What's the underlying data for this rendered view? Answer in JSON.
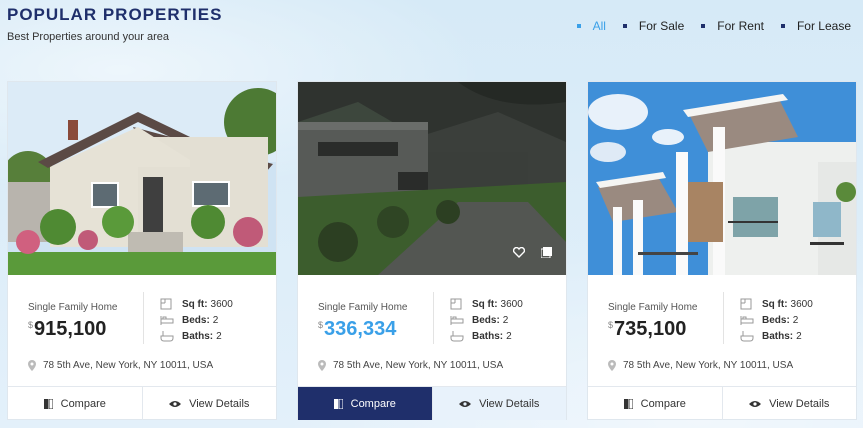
{
  "header": {
    "title": "POPULAR PROPERTIES",
    "subtitle": "Best Properties around your area"
  },
  "filters": [
    {
      "label": "All",
      "active": true
    },
    {
      "label": "For Sale",
      "active": false
    },
    {
      "label": "For Rent",
      "active": false
    },
    {
      "label": "For Lease",
      "active": false
    }
  ],
  "cards": [
    {
      "type": "Single Family Home",
      "currency": "$",
      "price": "915,100",
      "sqft_label": "Sq ft:",
      "sqft": "3600",
      "beds_label": "Beds:",
      "beds": "2",
      "baths_label": "Baths:",
      "baths": "2",
      "address": "78 5th Ave, New York, NY 10011, USA",
      "compare_label": "Compare",
      "details_label": "View Details"
    },
    {
      "type": "Single Family Home",
      "currency": "$",
      "price": "336,334",
      "sqft_label": "Sq ft:",
      "sqft": "3600",
      "beds_label": "Beds:",
      "beds": "2",
      "baths_label": "Baths:",
      "baths": "2",
      "address": "78 5th Ave, New York, NY 10011, USA",
      "compare_label": "Compare",
      "details_label": "View Details"
    },
    {
      "type": "Single Family Home",
      "currency": "$",
      "price": "735,100",
      "sqft_label": "Sq ft:",
      "sqft": "3600",
      "beds_label": "Beds:",
      "beds": "2",
      "baths_label": "Baths:",
      "baths": "2",
      "address": "78 5th Ave, New York, NY 10011, USA",
      "compare_label": "Compare",
      "details_label": "View Details"
    }
  ],
  "colors": {
    "brand_navy": "#1f2f6b",
    "accent_blue": "#3aa0e8"
  }
}
